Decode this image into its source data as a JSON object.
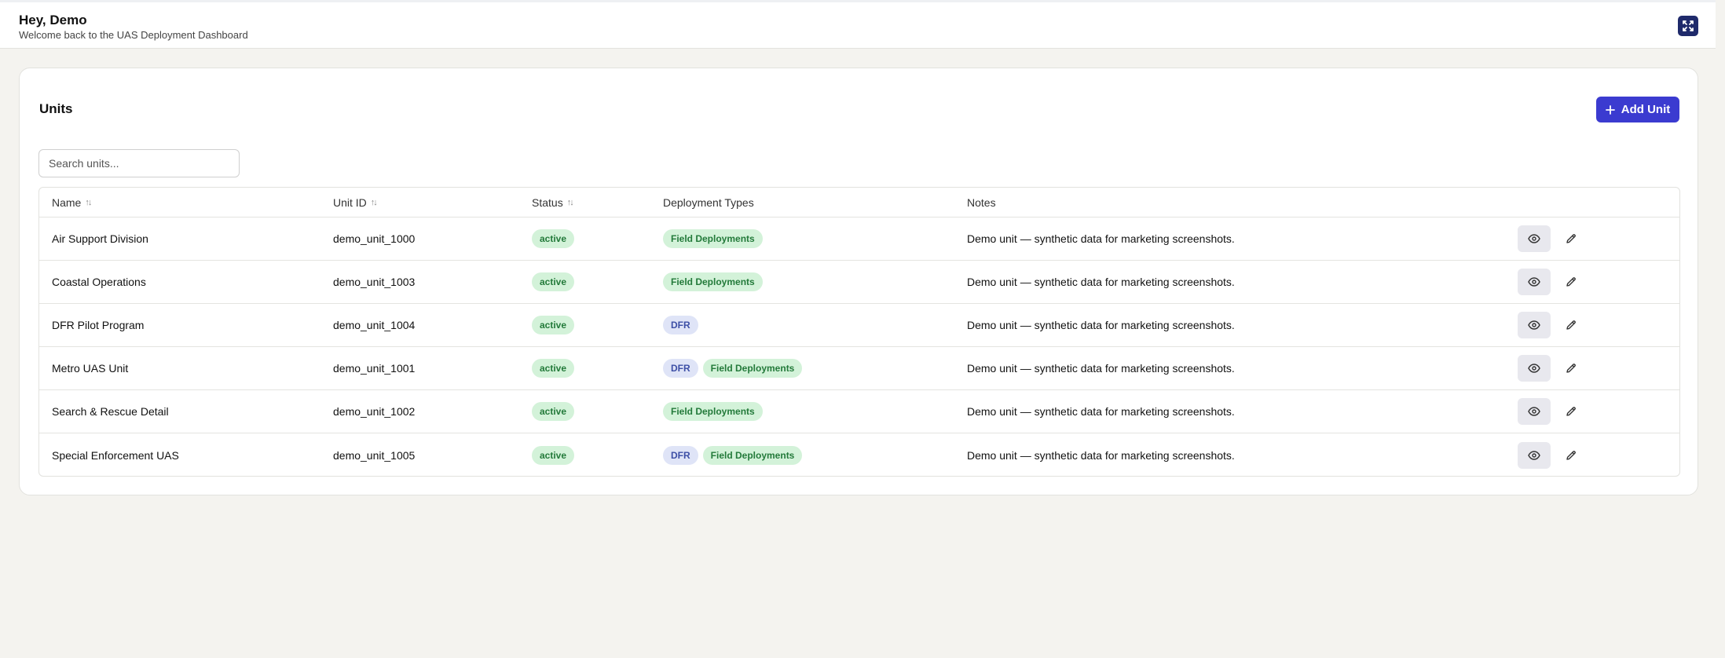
{
  "header": {
    "greeting": "Hey, Demo",
    "subtitle": "Welcome back to the UAS Deployment Dashboard",
    "expand_icon": "expand-icon"
  },
  "units_card": {
    "title": "Units",
    "add_button_label": "Add Unit",
    "search_placeholder": "Search units...",
    "columns": {
      "name": "Name",
      "unit_id": "Unit ID",
      "status": "Status",
      "deployment_types": "Deployment Types",
      "notes": "Notes"
    },
    "rows": [
      {
        "name": "Air Support Division",
        "unit_id": "demo_unit_1000",
        "status": "active",
        "types": [
          "Field Deployments"
        ],
        "notes": "Demo unit — synthetic data for marketing screenshots."
      },
      {
        "name": "Coastal Operations",
        "unit_id": "demo_unit_1003",
        "status": "active",
        "types": [
          "Field Deployments"
        ],
        "notes": "Demo unit — synthetic data for marketing screenshots."
      },
      {
        "name": "DFR Pilot Program",
        "unit_id": "demo_unit_1004",
        "status": "active",
        "types": [
          "DFR"
        ],
        "notes": "Demo unit — synthetic data for marketing screenshots."
      },
      {
        "name": "Metro UAS Unit",
        "unit_id": "demo_unit_1001",
        "status": "active",
        "types": [
          "DFR",
          "Field Deployments"
        ],
        "notes": "Demo unit — synthetic data for marketing screenshots."
      },
      {
        "name": "Search & Rescue Detail",
        "unit_id": "demo_unit_1002",
        "status": "active",
        "types": [
          "Field Deployments"
        ],
        "notes": "Demo unit — synthetic data for marketing screenshots."
      },
      {
        "name": "Special Enforcement UAS",
        "unit_id": "demo_unit_1005",
        "status": "active",
        "types": [
          "DFR",
          "Field Deployments"
        ],
        "notes": "Demo unit — synthetic data for marketing screenshots."
      }
    ]
  },
  "colors": {
    "page_bg": "#f4f3ef",
    "primary": "#3b3bd0",
    "expand_button": "#1f2a6b",
    "active_badge_bg": "#d3f2d9",
    "active_badge_text": "#237a3a",
    "dfr_badge_bg": "#dfe4f7",
    "dfr_badge_text": "#3d4fa6"
  }
}
